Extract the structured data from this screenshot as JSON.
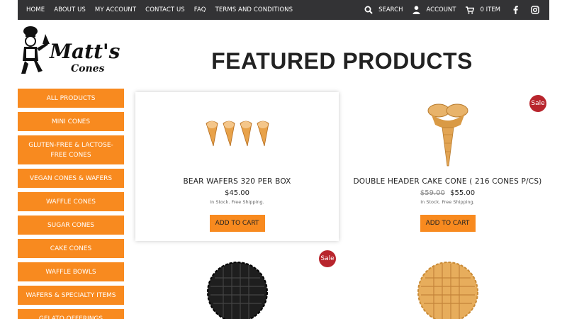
{
  "topbar": {
    "nav": [
      "HOME",
      "ABOUT US",
      "MY ACCOUNT",
      "CONTACT US",
      "FAQ",
      "TERMS AND CONDITIONS"
    ],
    "search_label": "SEARCH",
    "account_label": "ACCOUNT",
    "cart_label": "0 ITEM"
  },
  "logo": {
    "line1": "Matt's",
    "line2": "Cones"
  },
  "sidebar": {
    "categories": [
      "ALL PRODUCTS",
      "MINI CONES",
      "GLUTEN-FREE & LACTOSE-FREE CONES",
      "VEGAN CONES & WAFERS",
      "WAFFLE CONES",
      "SUGAR CONES",
      "CAKE CONES",
      "WAFFLE BOWLS",
      "WAFERS & SPECIALTY ITEMS",
      "GELATO OFFERINGS"
    ]
  },
  "main": {
    "title": "FEATURED PRODUCTS",
    "products": [
      {
        "name": "BEAR WAFERS 320 PER BOX",
        "price": "$45.00",
        "old_price": "",
        "stock": "In Stock. Free Shipping.",
        "button": "ADD TO CART",
        "sale": ""
      },
      {
        "name": "DOUBLE HEADER CAKE CONE ( 216 CONES P/CS)",
        "price": "$55.00",
        "old_price": "$59.00",
        "stock": "In Stock. Free Shipping.",
        "button": "ADD TO CART",
        "sale": "Sale"
      },
      {
        "sale": "Sale"
      },
      {
        "sale": ""
      }
    ]
  },
  "colors": {
    "accent": "#f88a1f",
    "topbar": "#333335",
    "sale": "#b8252d"
  }
}
